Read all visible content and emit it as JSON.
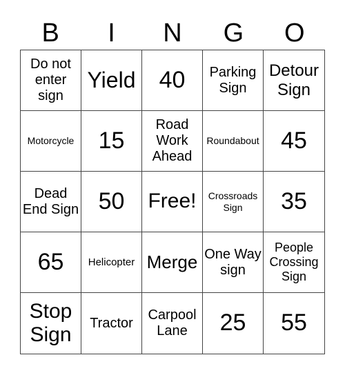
{
  "header": [
    "B",
    "I",
    "N",
    "G",
    "O"
  ],
  "cells": [
    {
      "text": "Do not enter sign",
      "size": 20
    },
    {
      "text": "Yield",
      "size": 32
    },
    {
      "text": "40",
      "size": 34
    },
    {
      "text": "Parking Sign",
      "size": 20
    },
    {
      "text": "Detour Sign",
      "size": 24
    },
    {
      "text": "Motorcycle",
      "size": 14
    },
    {
      "text": "15",
      "size": 34
    },
    {
      "text": "Road Work Ahead",
      "size": 20
    },
    {
      "text": "Roundabout",
      "size": 14
    },
    {
      "text": "45",
      "size": 34
    },
    {
      "text": "Dead End Sign",
      "size": 20
    },
    {
      "text": "50",
      "size": 34
    },
    {
      "text": "Free!",
      "size": 30
    },
    {
      "text": "Crossroads Sign",
      "size": 14
    },
    {
      "text": "35",
      "size": 34
    },
    {
      "text": "65",
      "size": 34
    },
    {
      "text": "Helicopter",
      "size": 15
    },
    {
      "text": "Merge",
      "size": 26
    },
    {
      "text": "One Way sign",
      "size": 20
    },
    {
      "text": "People Crossing Sign",
      "size": 18
    },
    {
      "text": "Stop Sign",
      "size": 30
    },
    {
      "text": "Tractor",
      "size": 20
    },
    {
      "text": "Carpool Lane",
      "size": 20
    },
    {
      "text": "25",
      "size": 34
    },
    {
      "text": "55",
      "size": 34
    }
  ]
}
